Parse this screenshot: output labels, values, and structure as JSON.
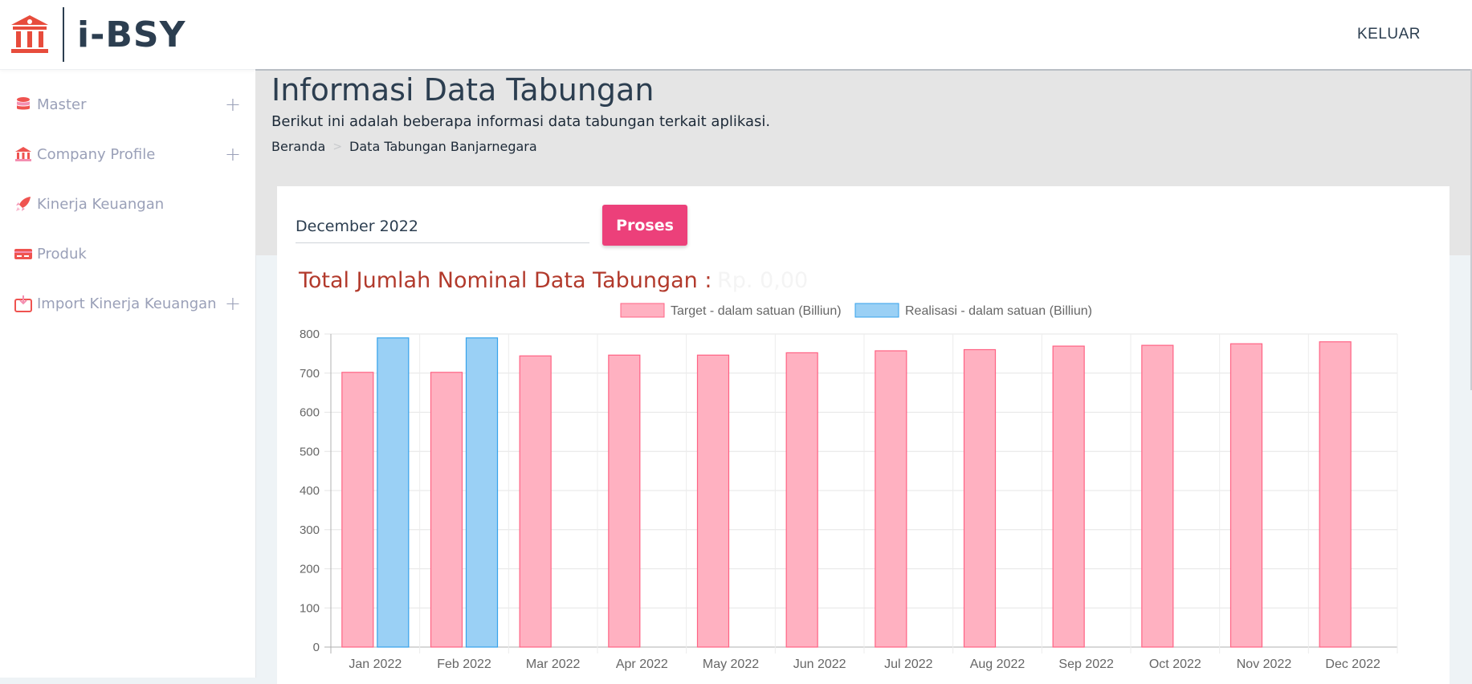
{
  "brand": {
    "name": "i-BSY",
    "icon": "bank-icon"
  },
  "sidebar": {
    "items": [
      {
        "label": "Master",
        "icon": "database-icon",
        "expandable": true
      },
      {
        "label": "Company Profile",
        "icon": "bank-icon",
        "expandable": true
      },
      {
        "label": "Kinerja Keuangan",
        "icon": "rocket-icon",
        "expandable": false
      },
      {
        "label": "Produk",
        "icon": "card-icon",
        "expandable": false
      },
      {
        "label": "Import Kinerja Keuangan",
        "icon": "import-icon",
        "expandable": true
      }
    ],
    "expand_glyph": "+"
  },
  "topbar": {
    "logout_label": "KELUAR"
  },
  "header": {
    "title": "Informasi Data Tabungan",
    "subtitle": "Berikut ini adalah beberapa informasi data tabungan terkait aplikasi.",
    "breadcrumb": [
      "Beranda",
      "Data Tabungan Banjarnegara"
    ],
    "breadcrumb_sep": ">"
  },
  "filter": {
    "period_value": "December 2022",
    "submit_label": "Proses"
  },
  "summary": {
    "label": "Total Jumlah Nominal Data Tabungan :",
    "value": "Rp. 0,00"
  },
  "colors": {
    "accent": "#ec407a",
    "target_fill": "#ffb1c1",
    "target_stroke": "#ff6384",
    "realisasi_fill": "#9ad0f5",
    "realisasi_stroke": "#36a2eb",
    "title_red": "#b23a2c"
  },
  "chart_data": {
    "type": "bar",
    "categories": [
      "Jan 2022",
      "Feb 2022",
      "Mar 2022",
      "Apr 2022",
      "May 2022",
      "Jun 2022",
      "Jul 2022",
      "Aug 2022",
      "Sep 2022",
      "Oct 2022",
      "Nov 2022",
      "Dec 2022"
    ],
    "series": [
      {
        "name": "Target - dalam satuan (Billiun)",
        "values": [
          702,
          702,
          744,
          746,
          746,
          752,
          757,
          760,
          769,
          771,
          775,
          780
        ]
      },
      {
        "name": "Realisasi - dalam satuan (Billiun)",
        "values": [
          790,
          790,
          null,
          null,
          null,
          null,
          null,
          null,
          null,
          null,
          null,
          null
        ]
      }
    ],
    "yticks": [
      0,
      100,
      200,
      300,
      400,
      500,
      600,
      700,
      800
    ],
    "ylim": [
      0,
      800
    ],
    "grid": true,
    "legend": "top"
  }
}
